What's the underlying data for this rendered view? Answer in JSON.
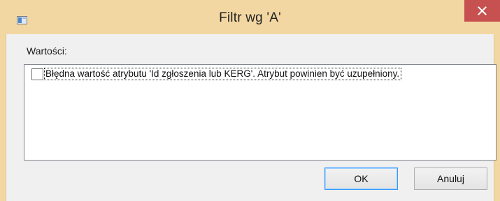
{
  "window": {
    "title": "Filtr wg 'A'",
    "close_icon": "close-icon"
  },
  "values": {
    "label": "Wartości:",
    "items": [
      {
        "checked": false,
        "label": "Błędna wartość atrybutu 'Id zgłoszenia lub KERG'. Atrybut powinien być uzupełniony."
      }
    ]
  },
  "buttons": {
    "ok_label": "OK",
    "cancel_label": "Anuluj"
  },
  "colors": {
    "titlebar": "#f3d7a3",
    "close_button": "#c75050",
    "client_background": "#f0f0f0",
    "default_button_border": "#3399ff"
  }
}
